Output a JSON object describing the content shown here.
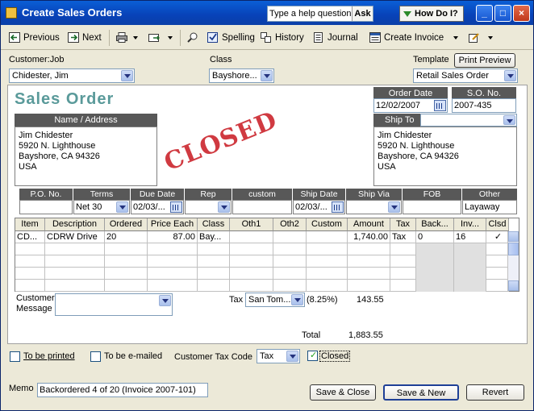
{
  "window": {
    "title": "Create Sales Orders"
  },
  "help": {
    "placeholder": "Type a help question",
    "ask_label": "Ask",
    "howdo_label": "How Do I?"
  },
  "toolbar": {
    "previous": "Previous",
    "next": "Next",
    "spelling": "Spelling",
    "history": "History",
    "journal": "Journal",
    "create_invoice": "Create Invoice"
  },
  "header": {
    "customer_label": "Customer:Job",
    "customer_value": "Chidester, Jim",
    "class_label": "Class",
    "class_value": "Bayshore...",
    "template_label": "Template",
    "print_preview": "Print Preview",
    "template_value": "Retail Sales Order"
  },
  "form": {
    "title": "Sales Order",
    "order_date_label": "Order Date",
    "order_date": "12/02/2007",
    "so_no_label": "S.O. No.",
    "so_no": "2007-435",
    "name_address_label": "Name / Address",
    "name_address": [
      "Jim Chidester",
      "5920 N. Lighthouse",
      "Bayshore, CA  94326",
      "USA"
    ],
    "ship_to_label": "Ship To",
    "ship_to": [
      "Jim Chidester",
      "5920 N. Lighthouse",
      "Bayshore, CA  94326",
      "USA"
    ],
    "stamp": "CLOSED"
  },
  "info_row": {
    "headers": [
      "P.O. No.",
      "Terms",
      "Due Date",
      "Rep",
      "custom",
      "Ship Date",
      "Ship Via",
      "FOB",
      "Other"
    ],
    "values": [
      "",
      "Net 30",
      "02/03/...",
      "",
      "",
      "02/03/...",
      "",
      "",
      "Layaway"
    ]
  },
  "lines": {
    "headers": [
      "Item",
      "Description",
      "Ordered",
      "Price Each",
      "Class",
      "Oth1",
      "Oth2",
      "Custom",
      "Amount",
      "Tax",
      "Back...",
      "Inv...",
      "Clsd"
    ],
    "rows": [
      [
        "CD...",
        "CDRW Drive",
        "20",
        "87.00",
        "Bay...",
        "",
        "",
        "",
        "1,740.00",
        "Tax",
        "0",
        "16",
        "✓"
      ]
    ]
  },
  "footer": {
    "customer_message_label": "Customer Message",
    "tax_label": "Tax",
    "tax_value": "San Tom...",
    "tax_rate": "(8.25%)",
    "tax_amount": "143.55",
    "total_label": "Total",
    "total_amount": "1,883.55"
  },
  "bottom": {
    "to_be_printed": "To be printed",
    "to_be_emailed": "To be e-mailed",
    "customer_tax_code_label": "Customer Tax Code",
    "customer_tax_code": "Tax",
    "closed_label": "Closed",
    "memo_label": "Memo",
    "memo_value": "Backordered 4 of 20 (Invoice 2007-101)",
    "save_close": "Save & Close",
    "save_new": "Save & New",
    "revert": "Revert"
  }
}
